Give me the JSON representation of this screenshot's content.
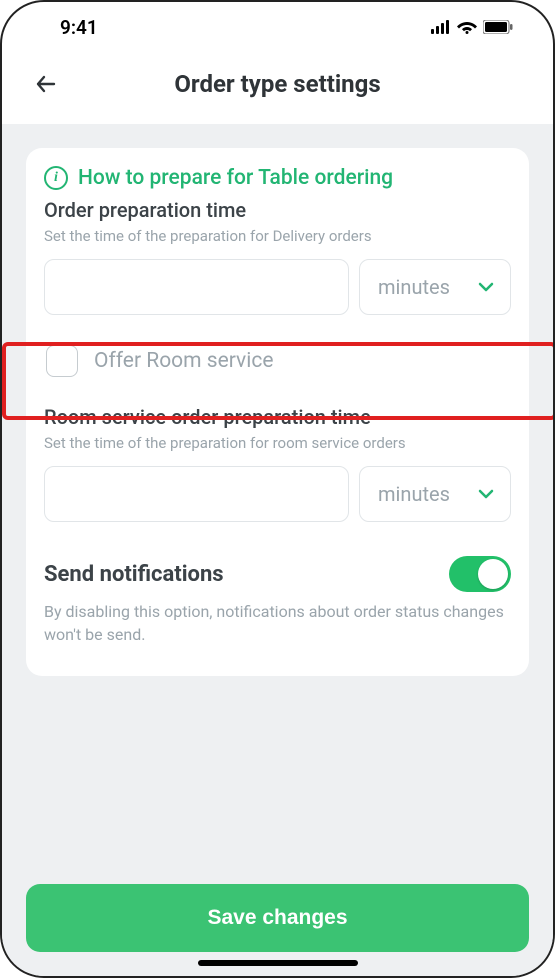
{
  "status": {
    "time": "9:41"
  },
  "header": {
    "title": "Order type settings"
  },
  "info": {
    "link_text": "How to prepare for Table ordering"
  },
  "prep": {
    "title": "Order preparation time",
    "desc": "Set the time of the preparation for Delivery orders",
    "unit_selected": "minutes"
  },
  "room_service": {
    "checkbox_label": "Offer Room service",
    "title": "Room service order preparation time",
    "desc": "Set the time of the preparation for room service orders",
    "unit_selected": "minutes"
  },
  "notifications": {
    "title": "Send notifications",
    "desc": "By disabling this option, notifications about order status changes won't be send.",
    "enabled": true
  },
  "footer": {
    "save_label": "Save changes"
  }
}
